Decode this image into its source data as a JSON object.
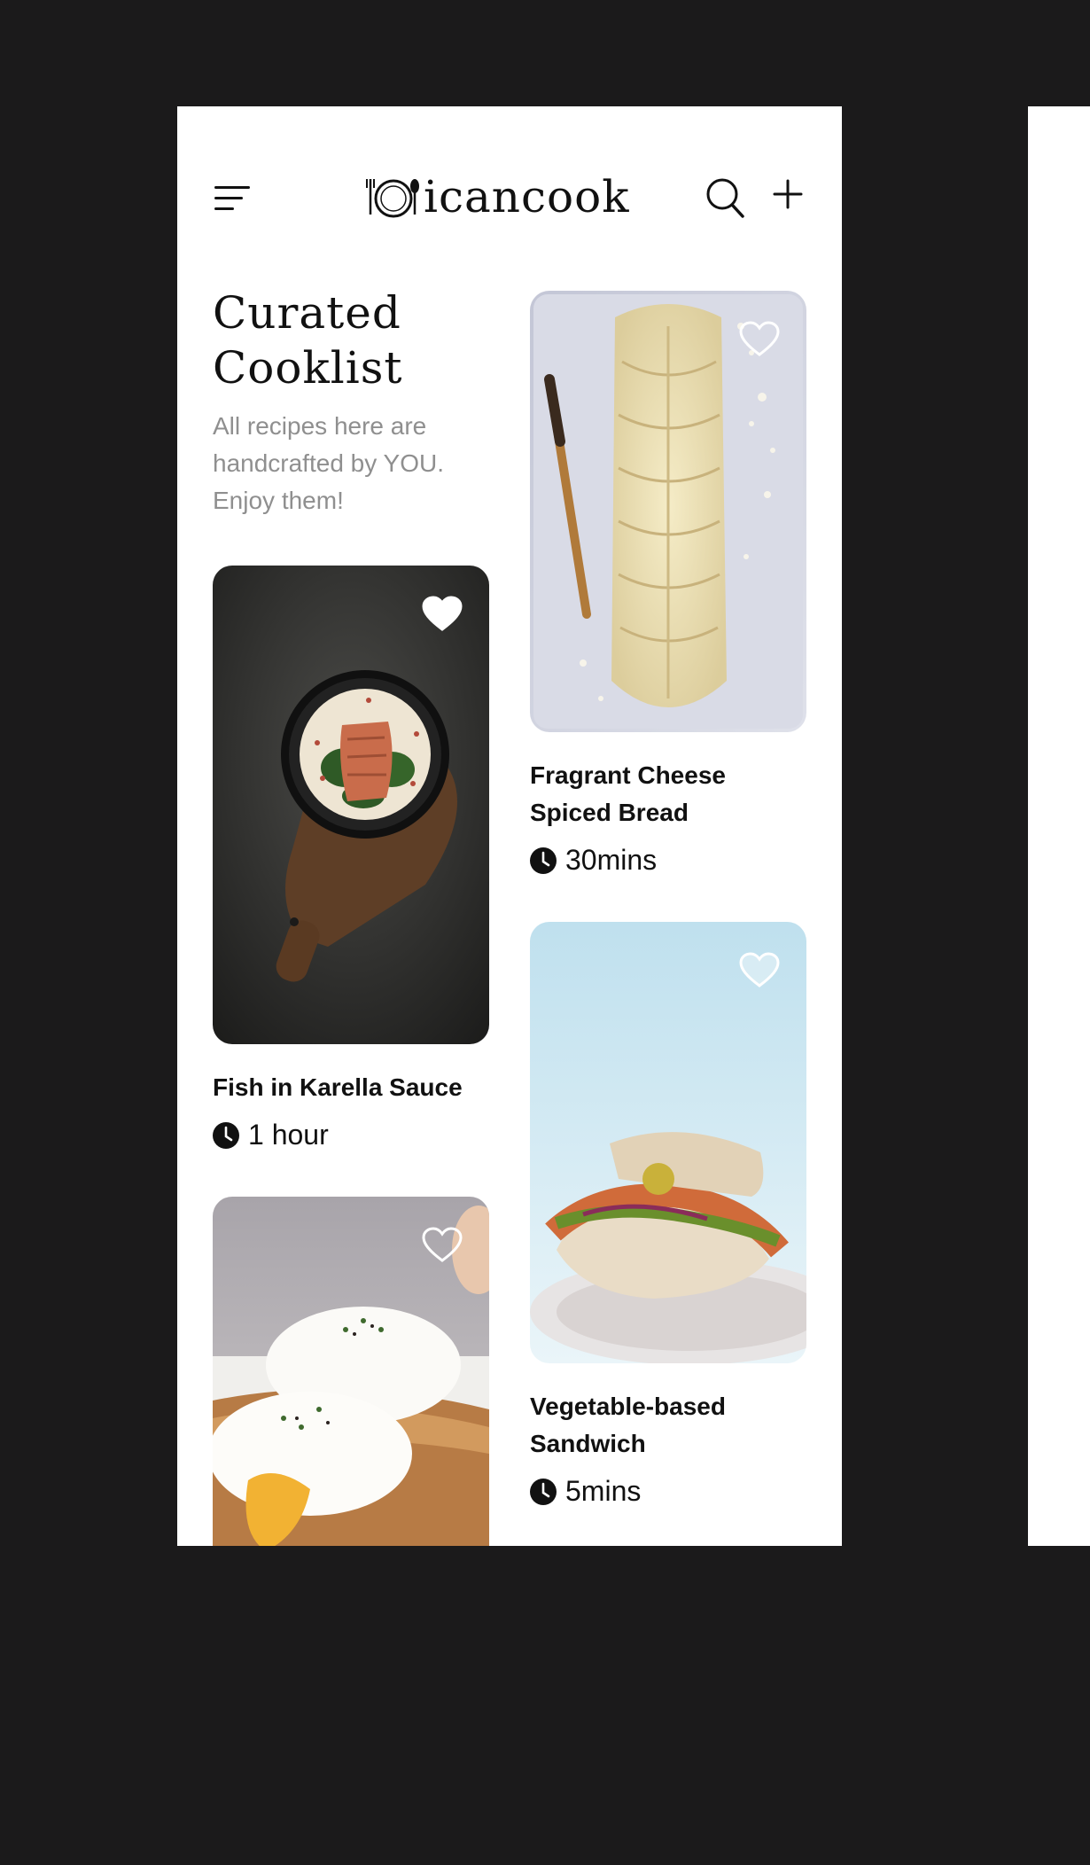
{
  "app": {
    "logo_text": "icancook"
  },
  "header": {
    "title": "Curated Cooklist",
    "subtitle": "All recipes here are handcrafted by YOU. Enjoy them!"
  },
  "recipes": [
    {
      "title": "Fragrant Cheese Spiced Bread",
      "time": "30mins",
      "favorited": false
    },
    {
      "title": "Fish in Karella Sauce",
      "time": "1 hour",
      "favorited": true
    },
    {
      "title": "Vegetable-based Sandwich",
      "time": "5mins",
      "favorited": false
    },
    {
      "title": "",
      "time": "",
      "favorited": false
    }
  ],
  "icons": [
    "menu-icon",
    "logo-icon",
    "search-icon",
    "plus-icon",
    "heart-icon",
    "clock-icon"
  ],
  "colors": {
    "background": "#1b1a1b",
    "surface": "#ffffff",
    "text": "#111111",
    "muted": "#8f8f8f"
  }
}
